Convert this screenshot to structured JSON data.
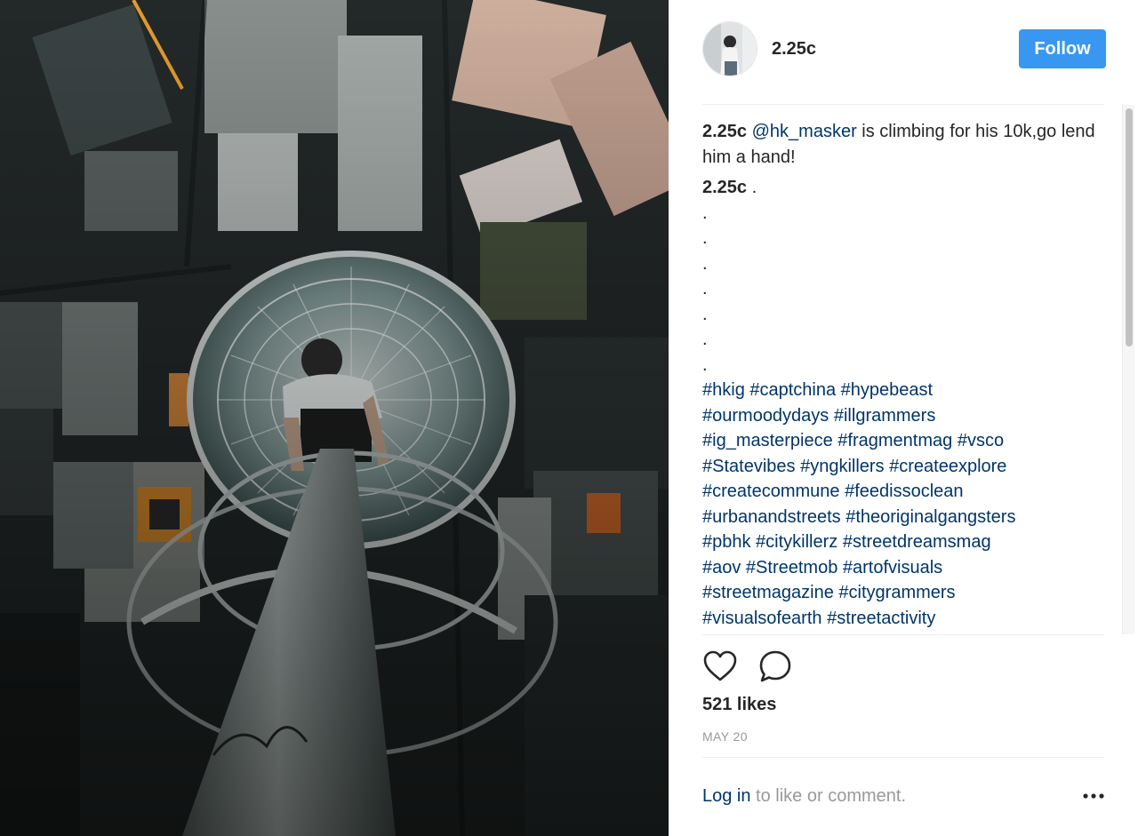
{
  "post": {
    "image_alt": "Aerial view looking down a tower mast with a climber above a city"
  },
  "header": {
    "username": "2.25c",
    "follow_label": "Follow"
  },
  "comments": {
    "caption_author": "2.25c",
    "caption_mention": "@hk_masker",
    "caption_text": " is climbing for his 10k,go lend him a hand!",
    "second_author": "2.25c",
    "second_text": " .",
    "dots": [
      ".",
      ".",
      ".",
      ".",
      ".",
      ".",
      "."
    ],
    "hashtag_lines": [
      "#hkig #captchina #hypebeast",
      "#ourmoodydays #illgrammers",
      "#ig_masterpiece #fragmentmag #vsco",
      "#Statevibes #yngkillers #createexplore",
      "#createcommune #feedissoclean",
      "#urbanandstreets #theoriginalgangsters",
      "#pbhk #citykillerz #streetdreamsmag",
      "#aov #Streetmob #artofvisuals",
      "#streetmagazine #citygrammers",
      "#visualsofearth #streetactivity"
    ]
  },
  "actions": {
    "like_icon": "heart-icon",
    "comment_icon": "comment-icon"
  },
  "stats": {
    "likes": "521 likes",
    "date": "MAY 20"
  },
  "footer": {
    "login_link": "Log in",
    "login_suffix": " to like or comment.",
    "more_icon": "more-options-icon"
  },
  "colors": {
    "follow_bg": "#3897f0",
    "link": "#003569",
    "muted": "#999999",
    "text": "#262626"
  }
}
